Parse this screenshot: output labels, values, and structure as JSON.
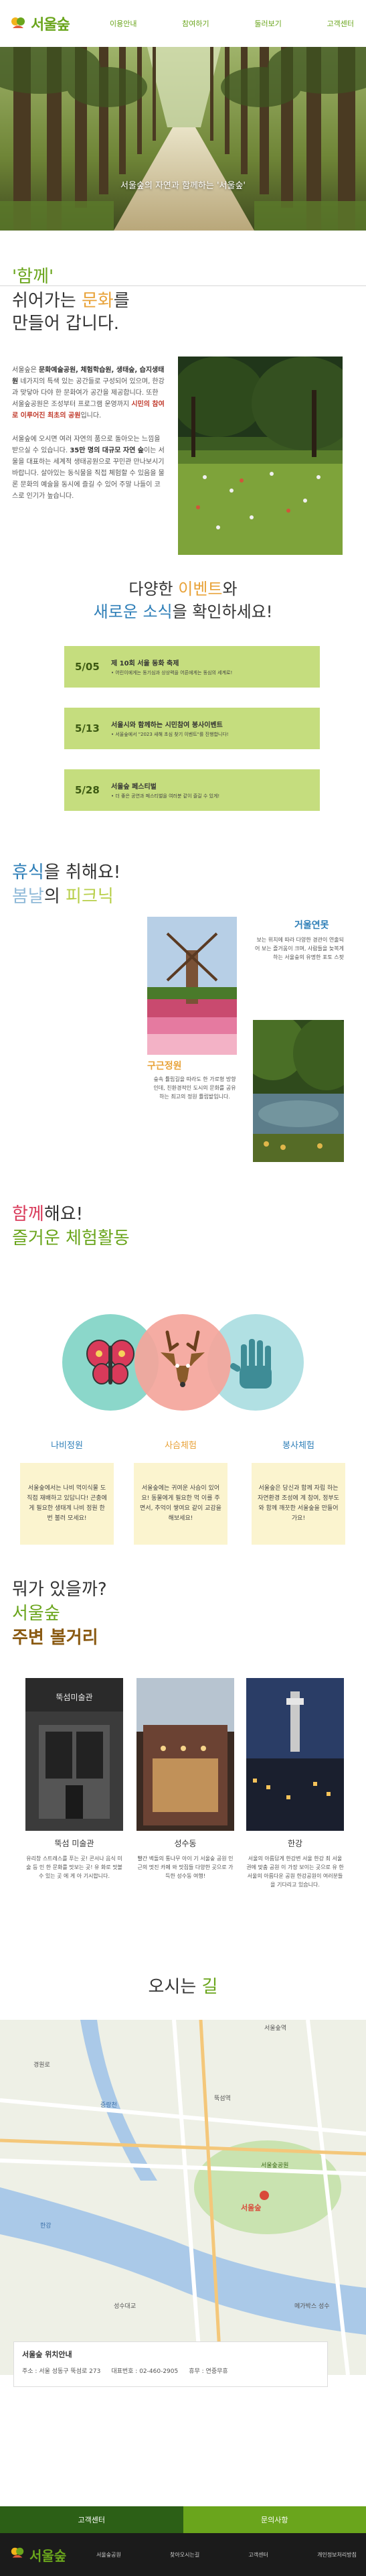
{
  "header": {
    "logo": "서울숲",
    "nav": [
      "이용안내",
      "참여하기",
      "둘러보기",
      "고객센터"
    ]
  },
  "hero": {
    "caption": "서울숲의 자연과 함께하는 '서울숲'"
  },
  "intro": {
    "heading_quote": "'함께'",
    "heading_line2_pre": "쉬어가는 ",
    "heading_line2_accent": "문화",
    "heading_line2_post": "를",
    "heading_line3": "만들어 갑니다.",
    "para1_pre": "서울숲은 ",
    "para1_bold": "문화예술공원, 체험학습원, 생태숲, 습지생태원",
    "para1_mid": " 네가지의 특색 있는 공간들로 구성되어 있으며, 한강과 맞닿아 다야 한 문화여가 공간을 제공합니다. 또한 서울숲공원은 조성부터 프로그램 운영까지 ",
    "para1_red": "시민의 참여로 이루어진 최초의 공원",
    "para1_post": "입니다.",
    "para2_pre": "서울숲에 오시면 여러 자연의 품으로 돌아오는 느낌을 받으실 수 있습니다. ",
    "para2_bold": "35만 명의 대규모 자연 숲",
    "para2_post": "이는 서울을 대표하는 세계적 생태공원으로 꾸민관 만나보시기 바랍니다. 살아있는 동식물을 직접 체험할 수 있음을 물론 문화의 예술을 동시에 즐길 수 있어 주말 나들이 코스로 인기가 높습니다."
  },
  "events": {
    "title_line1_pre": "다양한 ",
    "title_line1_accent": "이벤트",
    "title_line1_post": "와",
    "title_line2_accent": "새로운 소식",
    "title_line2_post": "을 확인하세요!",
    "items": [
      {
        "date": "5/05",
        "name": "제 10회 서울 동화 축제",
        "desc": "• 어린이에게는 동기심과 상상력을 어른에게는 동심의 세계로!"
      },
      {
        "date": "5/13",
        "name": "서울시와 함께하는 시민참여 봉사이벤트",
        "desc": "• 서울숲에서 \"2023 새해 초심 찾기 이벤트\"를 진행합니다!"
      },
      {
        "date": "5/28",
        "name": "서울숲 페스티벌",
        "desc": "• 더 좋은 공연과 페스티벌을 여러분 같이 즐길 수 있게!"
      }
    ]
  },
  "rest": {
    "title_line1_pre": "휴식",
    "title_line1_post": "을 취해요!",
    "title_line2_a": "봄날",
    "title_line2_b": "의 ",
    "title_line2_c": "피크닉",
    "card1_label": "구근정원",
    "card1_desc": "숲속 튤립길을 따라도 한 가로형 방향인데, 친환경적인 도시의 문화를 공유하는 최고의 정원 튤립밭입니다.",
    "card2_label": "거울연못",
    "card2_desc": "보는 위치에 따라 다양한 경관이 연출되어 보는 즐거움이 크며, 사람들을 늦복게하는 서울숲의 유명한 포토 스팟"
  },
  "experience": {
    "title_line1_pre": "함께",
    "title_line1_post": "해요!",
    "title_line2": "즐거운 체험활동",
    "cards": [
      {
        "label": "나비정원",
        "desc": "서울숲에서는 나비 먹이식물 도 직접 재배하고 있답니다! 곤충에게 필요한 생태계 나비 정원 한 번 불러 모세요!",
        "color": "#2f7fb8",
        "bg": "#fbf4cf"
      },
      {
        "label": "사슴체험",
        "desc": "서울숲에는 귀여운 사슴이 있어요! 동물에게 필요한 먹 이를 주면서, 추억이 쌓여요 같이 교감을 해보세요!",
        "color": "#e8a238",
        "bg": "#fbf4cf"
      },
      {
        "label": "봉사체험",
        "desc": "서울숲은 당신과 함께 자립 하는 자연환경 조성에 계 참여, 정부도와 함께 깨끗한 서울숲을 만들어가요!",
        "color": "#2f7fb8",
        "bg": "#fbf4cf"
      }
    ]
  },
  "nearby": {
    "title_line1": "뭐가 있을까?",
    "title_line2": "서울숲",
    "title_line3": "주변 볼거리",
    "cards": [
      {
        "name": "뚝섬 미술관",
        "desc": "유리창 스트레스를 푸는 곳! 콘서나 음식 미술 등 인 한 문화를 맛보는 곳! 유 화로 맛볼 수 있는 곳 에 게 아 기시합니다.",
        "sign": "뚝섬미술관"
      },
      {
        "name": "성수동",
        "desc": "빨간 벽돌의 통나무 아이 기 서울숲 공원 인근의 멋진 카페 와 맛집들 다양한 곳으로 가득한 성수동 여행!"
      },
      {
        "name": "한강",
        "desc": "서울의 아름답게 한강변 서울 한강 최 서울권에 맞춤 공원 이 가장 보이는 곳으로 유 한 서울의 아름다운 공원 한강공원이 여러분들을 기다리고 있습니다."
      }
    ]
  },
  "map_section": {
    "title_pre": "오시는 ",
    "title_accent": "길",
    "info_title": "서울숲 위치안내",
    "address": "주소 : 서울 성동구 뚝섬로 273",
    "phone": "대표번호 : 02-460-2905",
    "holiday": "휴무 : 연중무휴",
    "map_labels": [
      "서울숲",
      "서울숲역",
      "서울숲공원",
      "성수대교",
      "경원로",
      "뚝섬역",
      "중랑천",
      "한강",
      "메가박스 성수"
    ]
  },
  "bottom_bar": {
    "left": "고객센터",
    "right": "문의사항",
    "left_color": "#2c5f16",
    "right_color": "#6aa51c"
  },
  "footer": {
    "logo": "서울숲",
    "links": [
      "서울숲공원",
      "찾아오시는길",
      "고객센터",
      "개인정보처리방침"
    ]
  }
}
